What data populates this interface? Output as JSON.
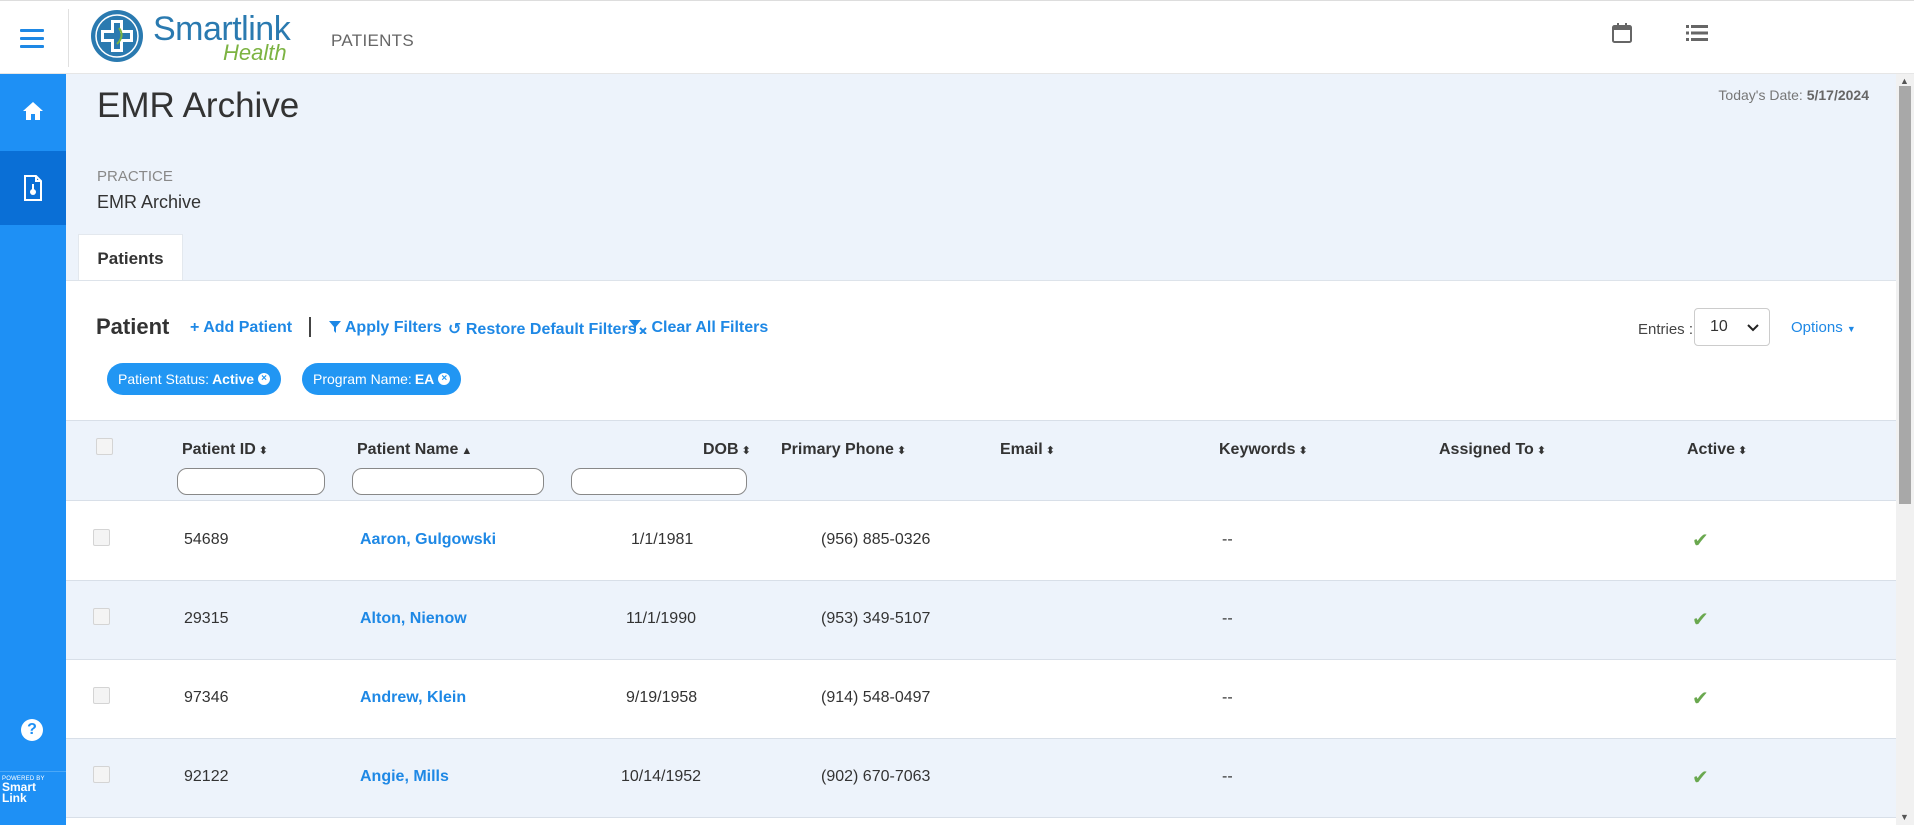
{
  "brand": {
    "name": "Smartlink",
    "sub": "Health"
  },
  "topbar": {
    "section": "PATIENTS",
    "calendar_icon": "calendar-icon",
    "list_icon": "list-icon"
  },
  "sidebar": {
    "items": [
      {
        "name": "home",
        "icon": "home-icon"
      },
      {
        "name": "patients",
        "icon": "patient-file-icon"
      }
    ],
    "help_glyph": "?",
    "powered_by": "POWERED BY",
    "powered_brand_1": "Smart",
    "powered_brand_2": "Link"
  },
  "page": {
    "title": "EMR Archive",
    "today_label": "Today's Date:",
    "today_value": "5/17/2024",
    "practice_label": "PRACTICE",
    "practice_value": "EMR Archive",
    "tab": "Patients"
  },
  "panel": {
    "title": "Patient",
    "add_patient": "Add Patient",
    "apply_filters": "Apply Filters",
    "restore_filters": "Restore Default Filters",
    "clear_filters": "Clear All Filters",
    "entries_label": "Entries :",
    "entries_value": "10",
    "options": "Options"
  },
  "chips": [
    {
      "label": "Patient Status:",
      "value": "Active"
    },
    {
      "label": "Program Name:",
      "value": "EA"
    }
  ],
  "table": {
    "headers": {
      "patient_id": "Patient ID",
      "patient_name": "Patient Name",
      "dob": "DOB",
      "primary_phone": "Primary Phone",
      "email": "Email",
      "keywords": "Keywords",
      "assigned_to": "Assigned To",
      "active": "Active"
    },
    "rows": [
      {
        "id": "54689",
        "name": "Aaron, Gulgowski",
        "dob": "1/1/1981",
        "phone": "(956) 885-0326",
        "email": "",
        "keywords": "--",
        "assigned": "",
        "active": "✔"
      },
      {
        "id": "29315",
        "name": "Alton, Nienow",
        "dob": "11/1/1990",
        "phone": "(953) 349-5107",
        "email": "",
        "keywords": "--",
        "assigned": "",
        "active": "✔"
      },
      {
        "id": "97346",
        "name": "Andrew, Klein",
        "dob": "9/19/1958",
        "phone": "(914) 548-0497",
        "email": "",
        "keywords": "--",
        "assigned": "",
        "active": "✔"
      },
      {
        "id": "92122",
        "name": "Angie, Mills",
        "dob": "10/14/1952",
        "phone": "(902) 670-7063",
        "email": "",
        "keywords": "--",
        "assigned": "",
        "active": "✔"
      }
    ]
  },
  "colors": {
    "primary": "#1e88e5",
    "sidebar": "#1e90f5",
    "sidebar_active": "#0a6fd6",
    "background": "#edf3fb",
    "check": "#6aa84f",
    "logo_green": "#7cb342"
  }
}
